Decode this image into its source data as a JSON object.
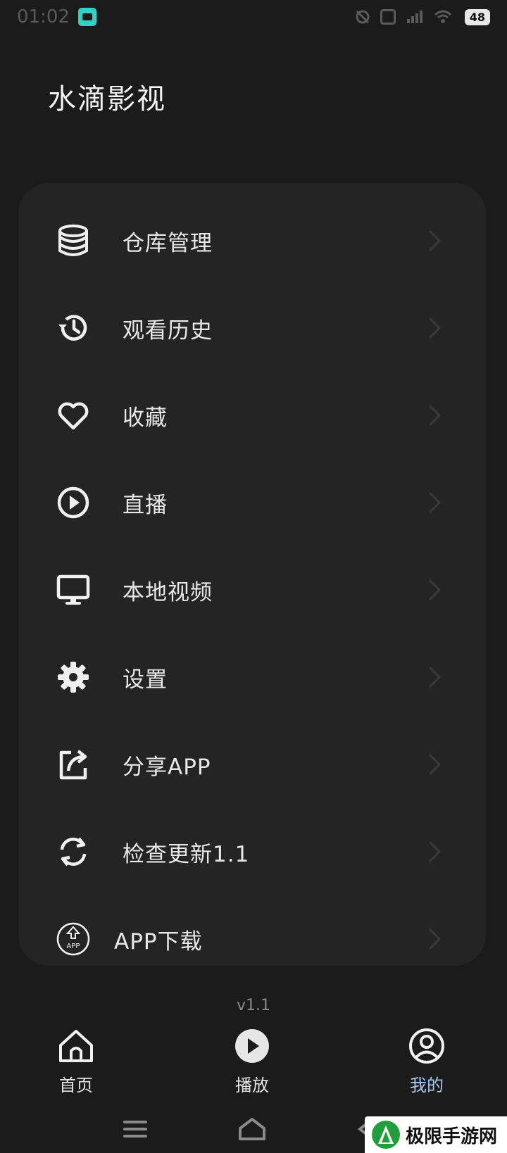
{
  "status_bar": {
    "time": "01:02",
    "battery": "48"
  },
  "header": {
    "title": "水滴影视"
  },
  "menu": {
    "items": [
      {
        "label": "仓库管理",
        "icon": "database-icon"
      },
      {
        "label": "观看历史",
        "icon": "history-icon"
      },
      {
        "label": "收藏",
        "icon": "heart-icon"
      },
      {
        "label": "直播",
        "icon": "play-circle-icon"
      },
      {
        "label": "本地视频",
        "icon": "monitor-icon"
      },
      {
        "label": "设置",
        "icon": "gear-icon"
      },
      {
        "label": "分享APP",
        "icon": "share-icon"
      },
      {
        "label": "检查更新1.1",
        "icon": "refresh-icon"
      },
      {
        "label": "APP下载",
        "icon": "app-download-icon"
      }
    ]
  },
  "footer": {
    "version": "v1.1"
  },
  "bottom_nav": {
    "tabs": [
      {
        "label": "首页",
        "icon": "home-icon"
      },
      {
        "label": "播放",
        "icon": "play-icon"
      },
      {
        "label": "我的",
        "icon": "user-icon",
        "active": true
      }
    ]
  },
  "watermark": {
    "text": "极限手游网"
  },
  "colors": {
    "background": "#1b1b1b",
    "card": "#242424",
    "active_tab": "#a9c9ef"
  }
}
